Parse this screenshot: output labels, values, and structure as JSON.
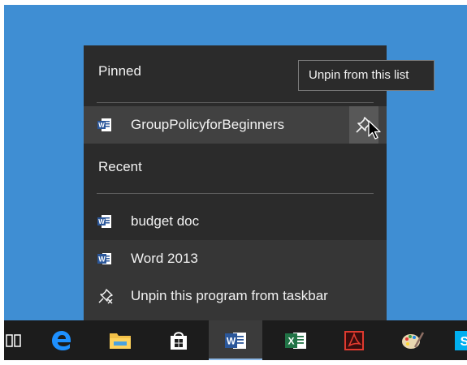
{
  "jumplist": {
    "pinned_header": "Pinned",
    "pinned_items": [
      {
        "label": "GroupPolicyforBeginners",
        "icon": "word-doc-icon"
      }
    ],
    "recent_header": "Recent",
    "recent_items": [
      {
        "label": "budget doc",
        "icon": "word-doc-icon"
      }
    ],
    "tasks": [
      {
        "label": "Word 2013",
        "icon": "word-app-icon"
      },
      {
        "label": "Unpin this program from taskbar",
        "icon": "unpin-icon"
      }
    ]
  },
  "tooltip": {
    "text": "Unpin from this list"
  },
  "taskbar": {
    "apps": [
      "task-view",
      "edge",
      "file-explorer",
      "store",
      "word",
      "excel",
      "acrobat",
      "paint",
      "skype"
    ],
    "active": "word"
  },
  "colors": {
    "desktop": "#3f8ed3",
    "menu_bg": "#2b2b2b",
    "hover_bg": "#414141",
    "taskbar_bg": "#1c1c1c",
    "word_blue": "#2b579a",
    "excel_green": "#217346"
  }
}
